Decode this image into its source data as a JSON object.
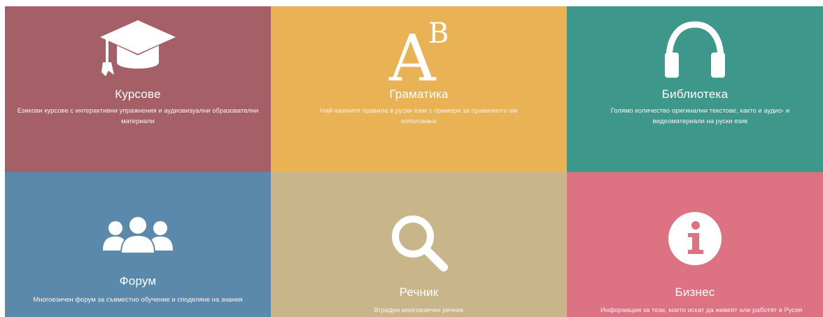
{
  "colors": {
    "courses": "#a45f67",
    "grammar": "#e9b254",
    "library": "#3d978a",
    "forum": "#5a89ab",
    "dictionary": "#c9b58a",
    "business": "#dd7283"
  },
  "tiles": {
    "courses": {
      "icon": "graduation-cap-icon",
      "title": "Курсове",
      "description": "Езикови курсове с интерактивни упражнения и аудиовизуални образователни материали"
    },
    "grammar": {
      "icon": "letters-ab-icon",
      "icon_big_letter": "A",
      "icon_small_letter": "B",
      "title": "Граматика",
      "description": "Най-важните правила в руски език с примери за правилното им използване"
    },
    "library": {
      "icon": "headphones-icon",
      "title": "Библиотека",
      "description": "Голямо количество оригинални текстове, както и аудио- и видеоматериали на руски език"
    },
    "forum": {
      "icon": "users-group-icon",
      "title": "Форум",
      "description": "Многоезичен форум за съвместно обучение и споделяне на знания"
    },
    "dictionary": {
      "icon": "magnifier-icon",
      "title": "Речник",
      "description": "Вграден многоезичен речник"
    },
    "business": {
      "icon": "info-icon",
      "title": "Бизнес",
      "description": "Информация за тези, които искат да живеят или работят в Русия"
    }
  }
}
